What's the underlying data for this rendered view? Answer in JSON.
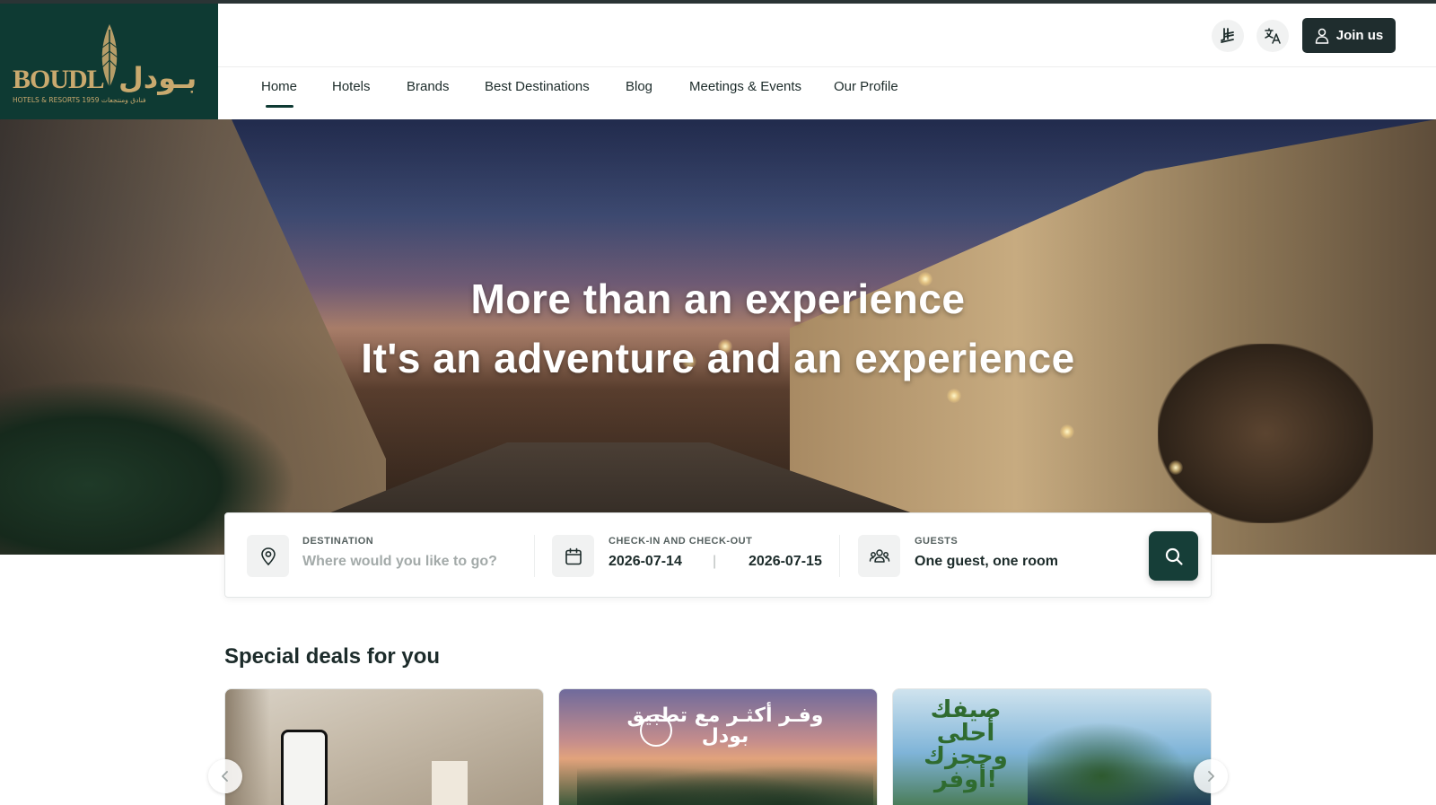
{
  "brand": {
    "logo_latin": "BOUDL",
    "logo_arabic": "بـودل",
    "logo_tagline": "HOTELS & RESORTS 1959 فنادق ومنتجعات"
  },
  "header": {
    "currency_icon": "riyal-icon",
    "language_icon": "translate-icon",
    "join_label": "Join us"
  },
  "nav": {
    "items": [
      {
        "label": "Home",
        "active": true
      },
      {
        "label": "Hotels"
      },
      {
        "label": "Brands"
      },
      {
        "label": "Best Destinations"
      },
      {
        "label": "Blog"
      },
      {
        "label": "Meetings & Events"
      },
      {
        "label": "Our Profile"
      }
    ]
  },
  "hero": {
    "title_line1": "More than an experience",
    "title_line2": "It's an adventure and an experience"
  },
  "search": {
    "destination_label": "DESTINATION",
    "destination_placeholder": "Where would you like to go?",
    "dates_label": "CHECK-IN AND CHECK-OUT",
    "check_in": "2026-07-14",
    "separator": "|",
    "check_out": "2026-07-15",
    "guests_label": "GUESTS",
    "guests_value": "One guest, one room"
  },
  "deals": {
    "title": "Special deals for you",
    "cards": [
      {
        "art_text": ""
      },
      {
        "art_text": "وفـر أكثـر مع تطبيق بودل"
      },
      {
        "art_text": "صيفك أحلى وحجزك أوفر!"
      }
    ]
  },
  "colors": {
    "primary": "#0e3a33",
    "dark_button": "#1f2d2e",
    "gold": "#c9a96e"
  }
}
